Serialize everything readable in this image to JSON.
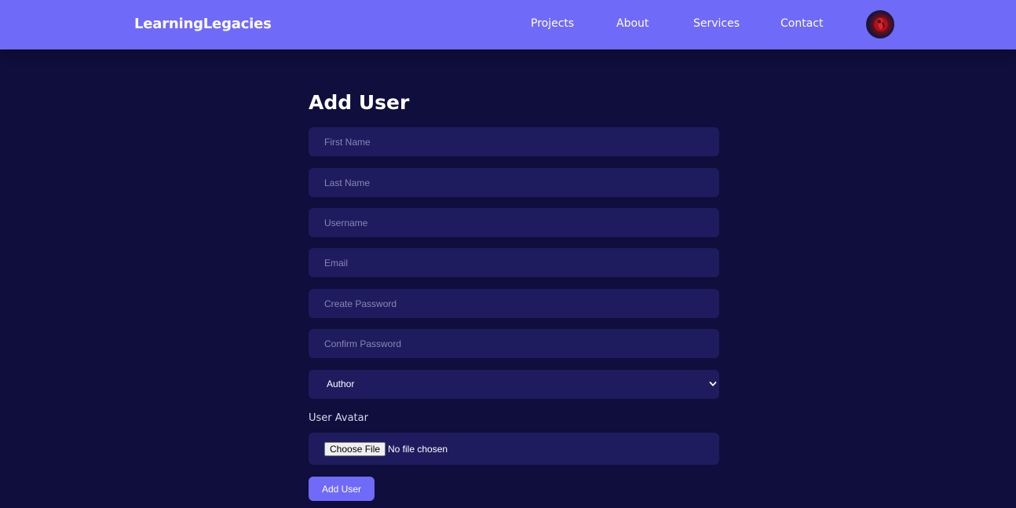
{
  "navbar": {
    "logo": "LearningLegacies",
    "links": [
      "Projects",
      "About",
      "Services",
      "Contact"
    ]
  },
  "form": {
    "title": "Add User",
    "fields": {
      "first_name": {
        "placeholder": "First Name",
        "value": ""
      },
      "last_name": {
        "placeholder": "Last Name",
        "value": ""
      },
      "username": {
        "placeholder": "Username",
        "value": ""
      },
      "email": {
        "placeholder": "Email",
        "value": ""
      },
      "create_password": {
        "placeholder": "Create Password",
        "value": ""
      },
      "confirm_password": {
        "placeholder": "Confirm Password",
        "value": ""
      }
    },
    "role_selected": "Author",
    "avatar_label": "User Avatar",
    "file_button": "Choose File",
    "file_status": "No file chosen",
    "submit": "Add User"
  },
  "colors": {
    "background": "#0f0e3c",
    "navbar": "#6f6af8",
    "input": "#1e1c5e",
    "accent": "#6f6af8"
  }
}
